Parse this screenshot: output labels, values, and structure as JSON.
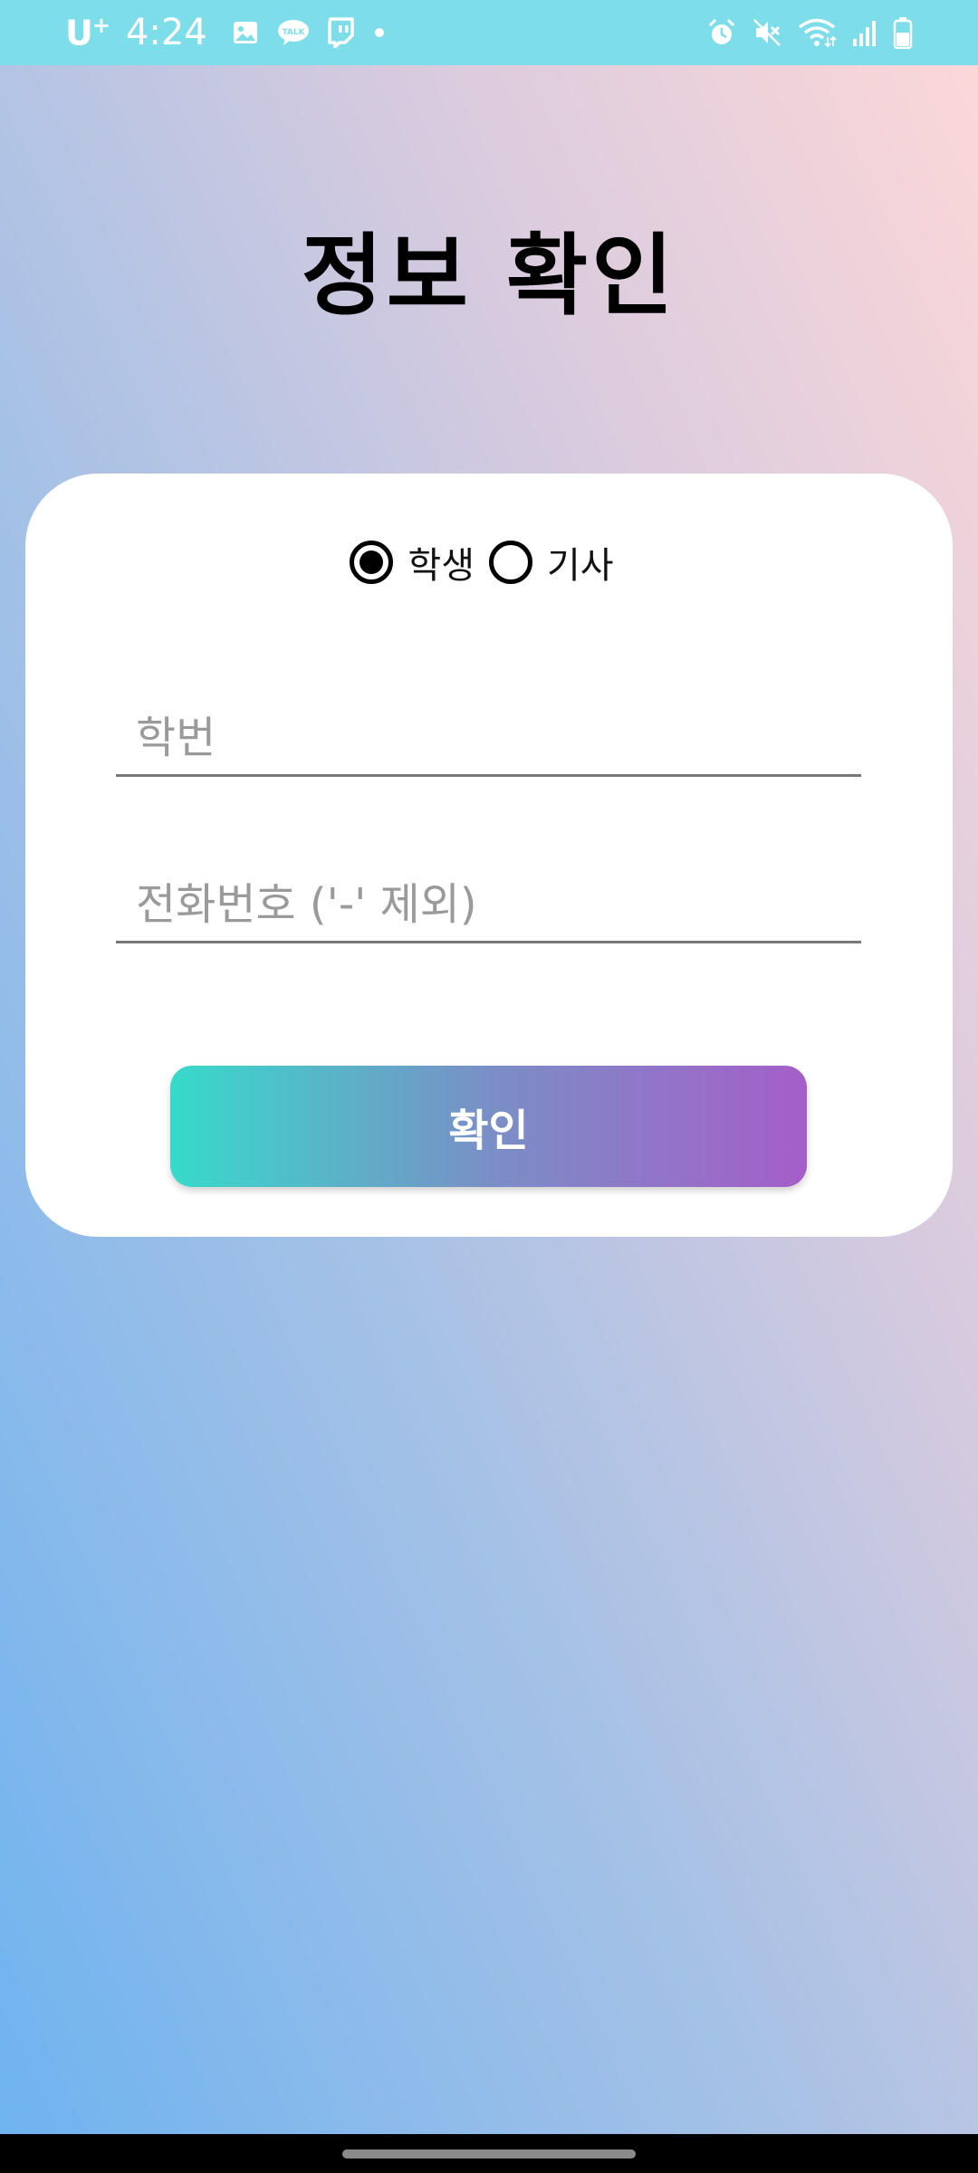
{
  "status_bar": {
    "carrier": "U",
    "carrier_sup": "+",
    "time": "4:24",
    "left_icons": [
      "image-icon",
      "kakaotalk-icon",
      "twitch-icon",
      "dot-icon"
    ],
    "right_icons": [
      "alarm-icon",
      "mute-icon",
      "wifi-icon",
      "signal-icon",
      "battery-icon"
    ],
    "background_color": "#7ddde9"
  },
  "header": {
    "title": "정보 확인"
  },
  "form": {
    "role_options": [
      {
        "label": "학생",
        "selected": true
      },
      {
        "label": "기사",
        "selected": false
      }
    ],
    "student_id": {
      "value": "",
      "placeholder": "학번"
    },
    "phone": {
      "value": "",
      "placeholder": "전화번호 ('-' 제외)"
    },
    "confirm_label": "확인"
  },
  "colors": {
    "button_gradient_start": "#37dacb",
    "button_gradient_end": "#a55ec9",
    "background_top": "#fdd8d8",
    "background_bottom": "#6eb3f0"
  }
}
